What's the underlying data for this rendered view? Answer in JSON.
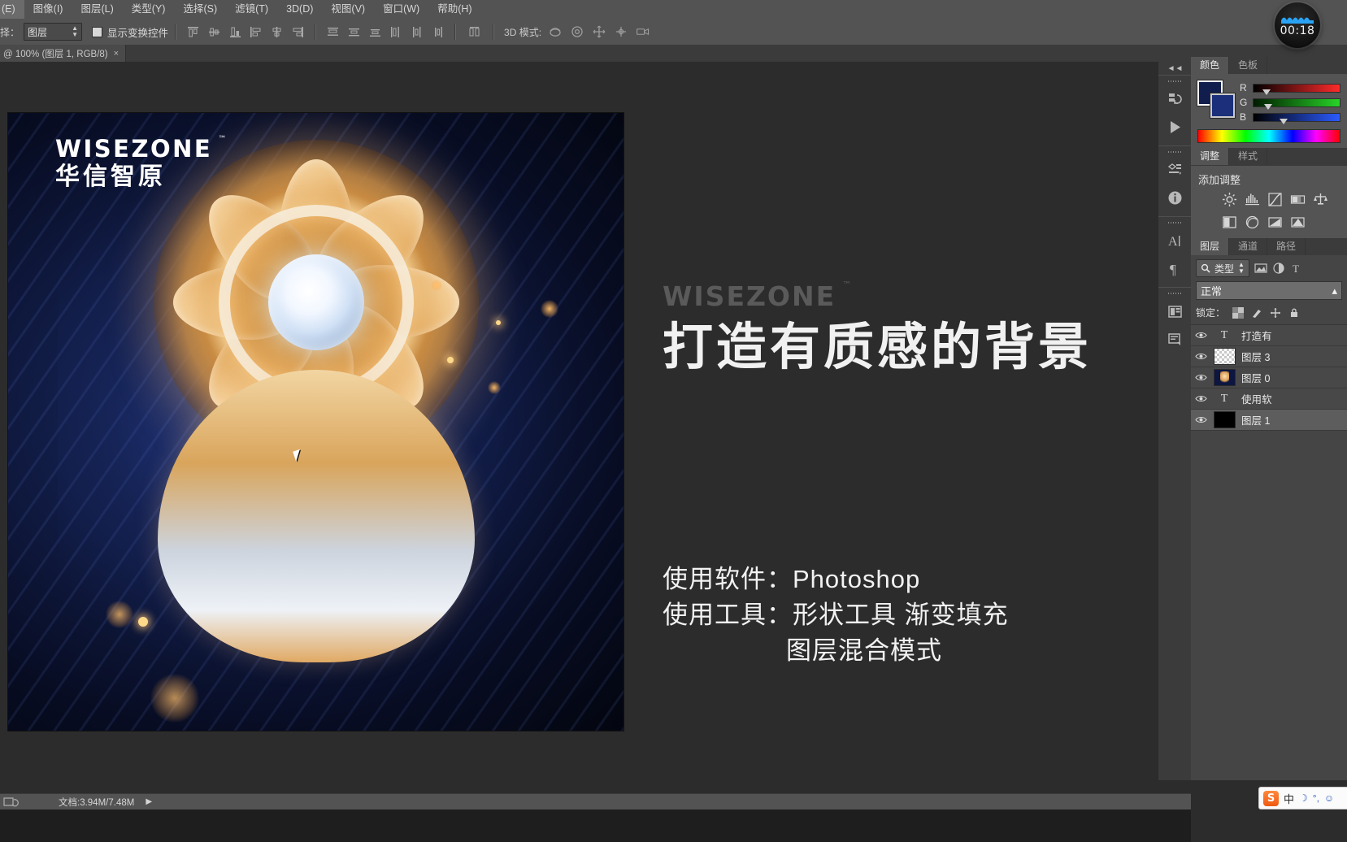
{
  "menubar": {
    "items": [
      {
        "label": "(E)"
      },
      {
        "label": "图像(I)"
      },
      {
        "label": "图层(L)"
      },
      {
        "label": "类型(Y)"
      },
      {
        "label": "选择(S)"
      },
      {
        "label": "滤镜(T)"
      },
      {
        "label": "3D(D)"
      },
      {
        "label": "视图(V)"
      },
      {
        "label": "窗口(W)"
      },
      {
        "label": "帮助(H)"
      }
    ]
  },
  "options_bar": {
    "select_label": "择：",
    "select_value": "图层",
    "show_transform_controls": "显示变换控件",
    "mode_3d_label": "3D 模式:"
  },
  "document_tab": {
    "title": "@ 100% (图层 1, RGB/8)",
    "close": "×"
  },
  "artboard": {
    "logo_en": "WISEZONE",
    "logo_tm": "™",
    "logo_cn": "华信智原"
  },
  "slide": {
    "watermark": "WISEZONE",
    "watermark_tm": "™",
    "title": "打造有质感的背景",
    "line1": "使用软件：Photoshop",
    "line2": "使用工具：形状工具 渐变填充",
    "line3": "图层混合模式"
  },
  "recorder": {
    "time": "00:18"
  },
  "color_panel": {
    "tabs": [
      {
        "label": "颜色",
        "active": true
      },
      {
        "label": "色板",
        "active": false
      }
    ],
    "channels": [
      {
        "label": "R"
      },
      {
        "label": "G"
      },
      {
        "label": "B"
      }
    ],
    "foreground_color": "#101d4d",
    "background_color": "#1b2f7a"
  },
  "adjustments_panel": {
    "tabs": [
      {
        "label": "调整",
        "active": true
      },
      {
        "label": "样式",
        "active": false
      }
    ],
    "title": "添加调整"
  },
  "layers_panel": {
    "tabs": [
      {
        "label": "图层",
        "active": true
      },
      {
        "label": "通道",
        "active": false
      },
      {
        "label": "路径",
        "active": false
      }
    ],
    "filter_value": "类型",
    "blend_mode": "正常",
    "lock_label": "锁定：",
    "layers": [
      {
        "name": "打造有",
        "kind": "text",
        "visible": true,
        "selected": false
      },
      {
        "name": "图层 3",
        "kind": "checker",
        "visible": true,
        "selected": false
      },
      {
        "name": "图层 0",
        "kind": "art",
        "visible": true,
        "selected": false
      },
      {
        "name": "使用软",
        "kind": "text",
        "visible": true,
        "selected": false
      },
      {
        "name": "图层 1",
        "kind": "black",
        "visible": true,
        "selected": true
      }
    ]
  },
  "statusbar": {
    "doc_info": "文档:3.94M/7.48M",
    "arrow": "▶"
  },
  "ime": {
    "logo": "S",
    "mode": "中",
    "moon": "☽",
    "degree": "°,",
    "face": "☺"
  },
  "colors": {
    "chrome_bg": "#535353",
    "panel_bg": "#454545",
    "canvas_bg": "#2c2c2c",
    "accent_blue": "#2b9ff0"
  }
}
